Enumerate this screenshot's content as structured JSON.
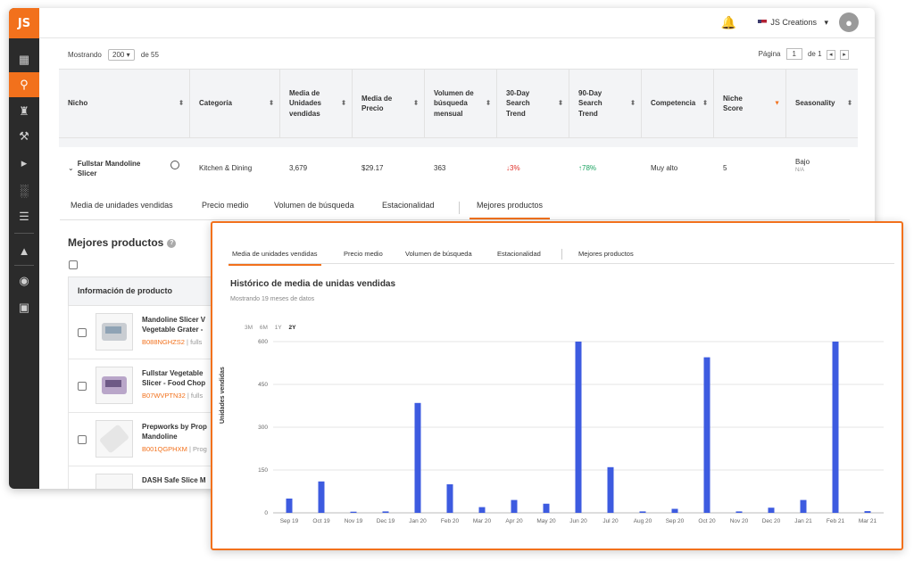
{
  "app": {
    "logo": "JS",
    "store_name": "JS Creations",
    "colors": {
      "accent": "#f2711c",
      "bar": "#3d5be0",
      "down": "#e0302a",
      "up": "#1aa260"
    }
  },
  "sidebar": {
    "icons": [
      "gift-icon",
      "search-icon",
      "castle-icon",
      "hammer-icon",
      "megaphone-icon",
      "bar-chart-icon",
      "graduation-icon",
      "school-icon",
      "chrome-icon",
      "cart-icon"
    ]
  },
  "pager": {
    "showing_label": "Mostrando",
    "per_page": "200",
    "of_label": "de 55",
    "page_label": "Página",
    "page": "1",
    "of_pages": "de 1"
  },
  "table": {
    "headers": [
      "Nicho",
      "Categoría",
      "Media de Unidades vendidas",
      "Media de Precio",
      "Volumen de búsqueda mensual",
      "30-Day Search Trend",
      "90-Day Search Trend",
      "Competencia",
      "Niche Score",
      "Seasonality"
    ],
    "row": {
      "niche": "Fullstar Mandoline Slicer",
      "category": "Kitchen & Dining",
      "units": "3,679",
      "price": "$29.17",
      "volume": "363",
      "trend30": "3%",
      "trend90": "78%",
      "competition": "Muy alto",
      "score": "5",
      "seasonality": "Bajo",
      "seasonality_sub": "N/A"
    }
  },
  "detail_tabs": [
    "Media de unidades vendidas",
    "Precio medio",
    "Volumen de búsqueda",
    "Estacionalidad",
    "Mejores productos"
  ],
  "best_products": {
    "title": "Mejores productos",
    "header": "Información de producto",
    "items": [
      {
        "title1": "Mandoline Slicer V",
        "title2": "Vegetable Grater -",
        "asin": "B088NGHZS2",
        "brand": "| fulls"
      },
      {
        "title1": "Fullstar Vegetable",
        "title2": "Slicer - Food Chop",
        "asin": "B07WVPTN32",
        "brand": "| fulls"
      },
      {
        "title1": "Prepworks by Prop",
        "title2": "Mandoline",
        "asin": "B001QGPHXM",
        "brand": "| Prog"
      },
      {
        "title1": "DASH Safe Slice M",
        "title2": "",
        "asin": "",
        "brand": ""
      }
    ]
  },
  "card": {
    "tabs": [
      "Media de unidades vendidas",
      "Precio medio",
      "Volumen de búsqueda",
      "Estacionalidad",
      "Mejores productos"
    ],
    "title": "Histórico de media de unidas vendidas",
    "subtitle": "Mostrando 19 meses de datos",
    "ranges": [
      "3M",
      "6M",
      "1Y",
      "2Y"
    ]
  },
  "chart_data": {
    "type": "bar",
    "categories": [
      "Sep 19",
      "Oct 19",
      "Nov 19",
      "Dec 19",
      "Jan 20",
      "Feb 20",
      "Mar 20",
      "Apr 20",
      "May 20",
      "Jun 20",
      "Jul 20",
      "Aug 20",
      "Sep 20",
      "Oct 20",
      "Nov 20",
      "Dec 20",
      "Jan 21",
      "Feb 21",
      "Mar 21"
    ],
    "values": [
      50,
      110,
      4,
      5,
      385,
      100,
      20,
      45,
      32,
      600,
      160,
      5,
      14,
      545,
      5,
      18,
      45,
      600,
      6
    ],
    "ylabel": "Unidades vendidas",
    "yticks": [
      0,
      150,
      300,
      450,
      600
    ],
    "ylim": [
      0,
      600
    ],
    "grid": true
  }
}
